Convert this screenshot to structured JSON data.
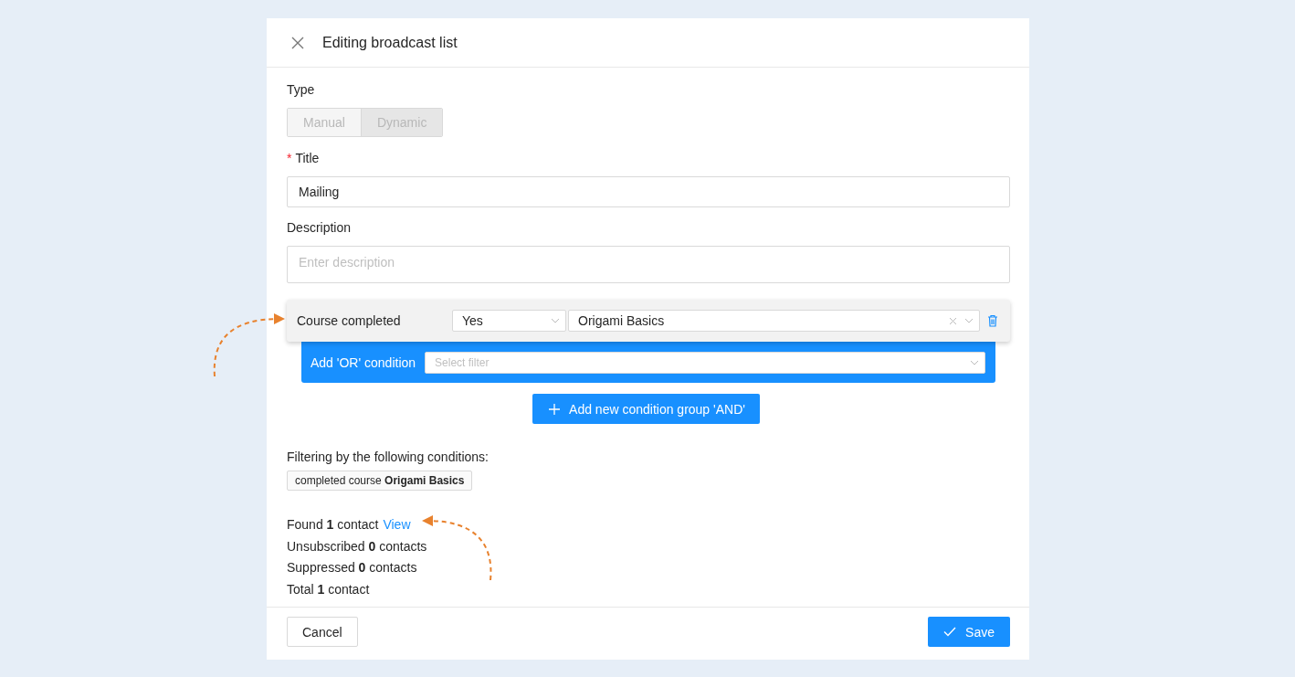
{
  "dialog": {
    "title": "Editing broadcast list"
  },
  "type": {
    "label": "Type",
    "disabled": true,
    "options": [
      {
        "label": "Manual",
        "selected": false
      },
      {
        "label": "Dynamic",
        "selected": true
      }
    ]
  },
  "title_field": {
    "label": "Title",
    "required": true,
    "required_mark": "*",
    "value": "Mailing"
  },
  "description_field": {
    "label": "Description",
    "placeholder": "Enter description"
  },
  "condition": {
    "label": "Course completed",
    "operator": "Yes",
    "value": "Origami Basics"
  },
  "or_condition": {
    "label": "Add 'OR' condition",
    "placeholder": "Select filter"
  },
  "add_group_button": "Add new condition group 'AND'",
  "filtering": {
    "heading": "Filtering by the following conditions:",
    "tags": [
      "completed course **Origami Basics**"
    ]
  },
  "stats": [
    {
      "text": "Found **1** contact",
      "link": "View"
    },
    {
      "text": "Unsubscribed **0** contacts"
    },
    {
      "text": "Suppressed **0** contacts"
    },
    {
      "text": "Total **1** contact"
    }
  ],
  "footer": {
    "cancel": "Cancel",
    "save": "Save"
  }
}
